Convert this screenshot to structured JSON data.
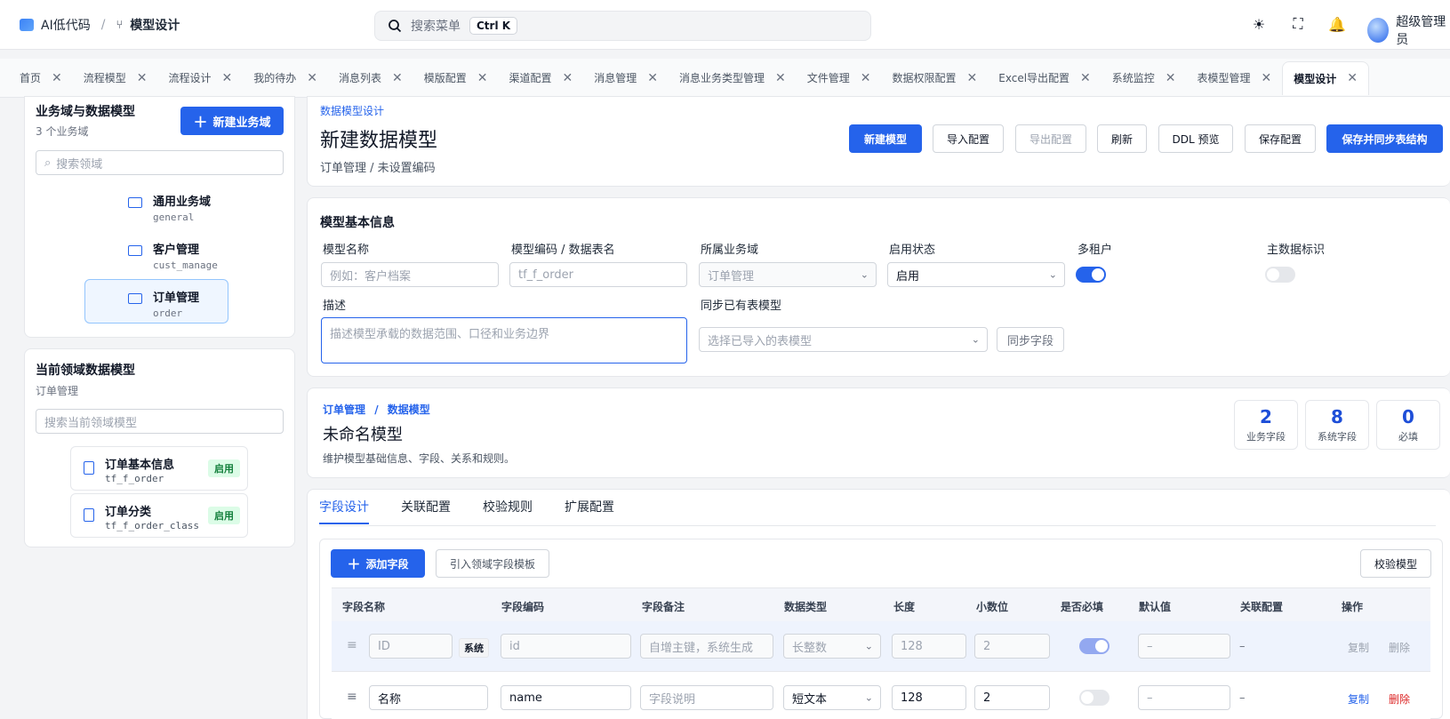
{
  "header": {
    "app_title": "AI低代码",
    "breadcrumb": "模型设计",
    "search_placeholder": "搜索菜单",
    "search_shortcut": "Ctrl K",
    "user_name": "超级管理员"
  },
  "tabs": [
    {
      "label": "首页"
    },
    {
      "label": "流程模型"
    },
    {
      "label": "流程设计"
    },
    {
      "label": "我的待办"
    },
    {
      "label": "消息列表"
    },
    {
      "label": "模版配置"
    },
    {
      "label": "渠道配置"
    },
    {
      "label": "消息管理"
    },
    {
      "label": "消息业务类型管理"
    },
    {
      "label": "文件管理"
    },
    {
      "label": "数据权限配置"
    },
    {
      "label": "Excel导出配置"
    },
    {
      "label": "系统监控"
    },
    {
      "label": "表模型管理"
    },
    {
      "label": "模型设计",
      "active": true
    }
  ],
  "left": {
    "domains_title": "业务域与数据模型",
    "domains_count": "3 个业务域",
    "new_domain_button": "新建业务域",
    "domain_search_placeholder": "搜索领域",
    "domains": [
      {
        "name": "通用业务域",
        "code": "general"
      },
      {
        "name": "客户管理",
        "code": "cust_manage"
      },
      {
        "name": "订单管理",
        "code": "order"
      }
    ],
    "models_title": "当前领域数据模型",
    "models_domain": "订单管理",
    "model_search_placeholder": "搜索当前领域模型",
    "models": [
      {
        "name": "订单基本信息",
        "code": "tf_f_order",
        "status": "启用"
      },
      {
        "name": "订单分类",
        "code": "tf_f_order_class",
        "status": "启用"
      }
    ]
  },
  "designer": {
    "eyebrow": "数据模型设计",
    "title": "新建数据模型",
    "subtitle": "订单管理 / 未设置编码",
    "buttons": {
      "new_model": "新建模型",
      "import_config": "导入配置",
      "export_config": "导出配置",
      "refresh": "刷新",
      "ddl_preview": "DDL 预览",
      "save_config": "保存配置",
      "save_sync": "保存并同步表结构"
    }
  },
  "basic": {
    "section_title": "模型基本信息",
    "model_name_label": "模型名称",
    "model_name_placeholder": "例如：客户档案",
    "model_code_label": "模型编码 / 数据表名",
    "model_code_placeholder": "tf_f_order",
    "domain_label": "所属业务域",
    "domain_value": "订单管理",
    "status_label": "启用状态",
    "status_value": "启用",
    "multi_tenant_label": "多租户",
    "multi_tenant": true,
    "master_data_label": "主数据标识",
    "master_data": false,
    "desc_label": "描述",
    "desc_placeholder": "描述模型承载的数据范围、口径和业务边界",
    "sync_label": "同步已有表模型",
    "sync_placeholder": "选择已导入的表模型",
    "sync_button": "同步字段"
  },
  "summary": {
    "crumb_domain": "订单管理",
    "crumb_sep": "/",
    "crumb_model": "数据模型",
    "model_name": "未命名模型",
    "desc": "维护模型基础信息、字段、关系和规则。",
    "stats": [
      {
        "value": "2",
        "label": "业务字段"
      },
      {
        "value": "8",
        "label": "系统字段"
      },
      {
        "value": "0",
        "label": "必填"
      }
    ]
  },
  "field_design": {
    "tabs": [
      "字段设计",
      "关联配置",
      "校验规则",
      "扩展配置"
    ],
    "add_field": "添加字段",
    "import_template": "引入领域字段模板",
    "validate_model": "校验模型",
    "columns": [
      "字段名称",
      "字段编码",
      "字段备注",
      "数据类型",
      "长度",
      "小数位",
      "是否必填",
      "默认值",
      "关联配置",
      "操作"
    ],
    "rows": [
      {
        "name": "ID",
        "system_tag": "系统",
        "code": "id",
        "remark": "自增主键，系统生成",
        "type": "长整数",
        "length": "128",
        "scale": "2",
        "required": true,
        "default": "–",
        "relation": "–",
        "copy": "复制",
        "delete": "删除",
        "system": true
      },
      {
        "name": "名称",
        "code": "name",
        "remark": "字段说明",
        "type": "短文本",
        "length": "128",
        "scale": "2",
        "required": false,
        "default": "–",
        "relation": "–",
        "copy": "复制",
        "delete": "删除",
        "system": false
      }
    ]
  },
  "colors": {
    "primary": "#2563eb",
    "success": "#15803d",
    "danger": "#dc2626"
  }
}
